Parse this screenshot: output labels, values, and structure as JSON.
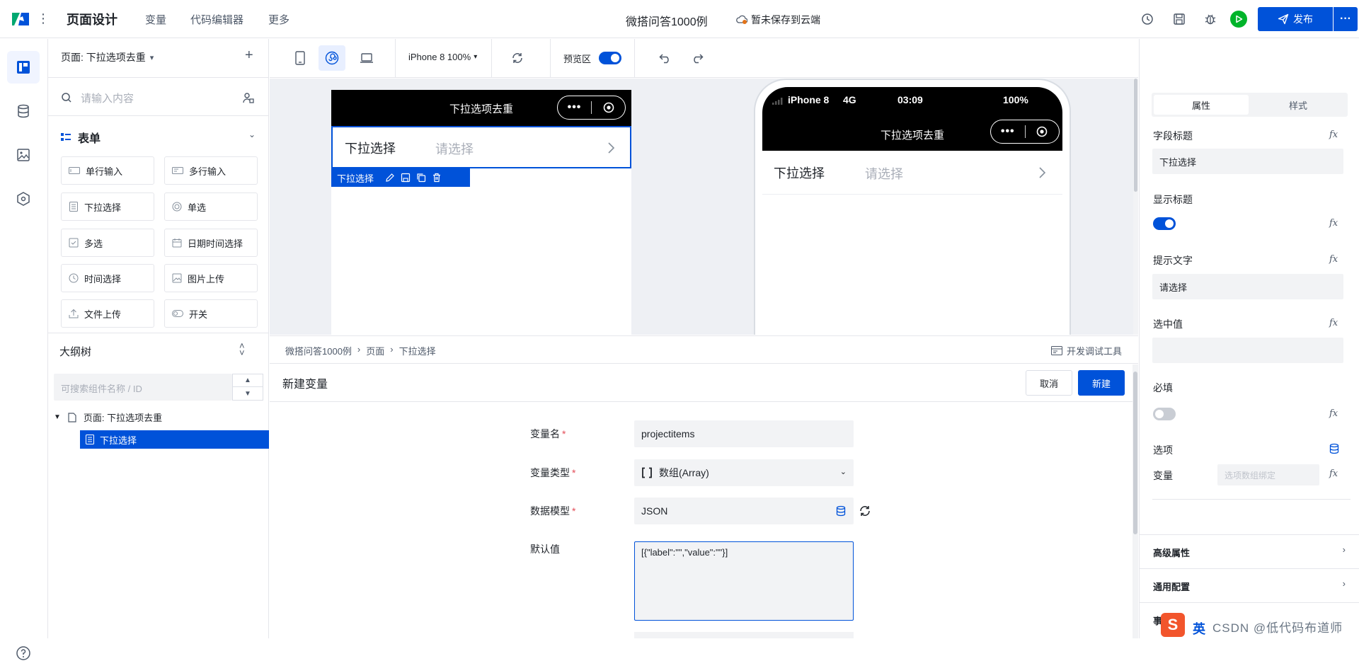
{
  "topbar": {
    "title": "页面设计",
    "nav": [
      "变量",
      "代码编辑器",
      "更多"
    ],
    "app_name": "微搭问答1000例",
    "cloud_status": "暂未保存到云端",
    "publish_label": "发布"
  },
  "leftpanel": {
    "page_label": "页面: 下拉选项去重",
    "search_placeholder": "请输入内容",
    "section_title": "表单",
    "components": [
      {
        "label": "单行输入",
        "icon": "input-icon"
      },
      {
        "label": "多行输入",
        "icon": "textarea-icon"
      },
      {
        "label": "下拉选择",
        "icon": "select-icon"
      },
      {
        "label": "单选",
        "icon": "radio-icon"
      },
      {
        "label": "多选",
        "icon": "checkbox-icon"
      },
      {
        "label": "日期时间选择",
        "icon": "calendar-icon"
      },
      {
        "label": "时间选择",
        "icon": "clock-icon"
      },
      {
        "label": "图片上传",
        "icon": "image-upload-icon"
      },
      {
        "label": "文件上传",
        "icon": "upload-icon"
      },
      {
        "label": "开关",
        "icon": "switch-icon"
      }
    ],
    "outline_title": "大纲树",
    "outline_search_placeholder": "可搜索组件名称 / ID",
    "tree": {
      "page": "页面: 下拉选项去重",
      "selected": "下拉选择"
    }
  },
  "toolbar": {
    "device": "iPhone 8 100%",
    "preview_label": "预览区",
    "preview_on": true
  },
  "canvas": {
    "nav_title": "下拉选项去重",
    "row_label": "下拉选择",
    "row_placeholder": "请选择",
    "selection_tag": "下拉选择",
    "phone_status": {
      "carrier": "iPhone 8",
      "network": "4G",
      "time": "03:09",
      "battery": "100%"
    }
  },
  "breadcrumb": {
    "items": [
      "微搭问答1000例",
      "页面",
      "下拉选择"
    ],
    "devtool_label": "开发调试工具"
  },
  "var_panel": {
    "title": "新建变量",
    "cancel_label": "取消",
    "create_label": "新建",
    "fields": {
      "name_label": "变量名",
      "name_value": "projectitems",
      "type_label": "变量类型",
      "type_value": "数组(Array)",
      "model_label": "数据模型",
      "model_value": "JSON",
      "default_label": "默认值",
      "default_value": "[{\"label\":\"\",\"value\":\"\"}]"
    }
  },
  "right_panel": {
    "tabs": [
      "属性",
      "样式"
    ],
    "active_tab": "属性",
    "field_title_label": "字段标题",
    "field_title_value": "下拉选择",
    "show_title_label": "显示标题",
    "show_title_on": true,
    "hint_label": "提示文字",
    "hint_value": "请选择",
    "selected_value_label": "选中值",
    "selected_value": "",
    "required_label": "必填",
    "required_on": false,
    "options_label": "选项",
    "variable_label": "变量",
    "variable_placeholder": "选项数组绑定",
    "fx_label": "fx",
    "sections": [
      "高级属性",
      "通用配置"
    ],
    "partial_label": "事"
  },
  "overlay": {
    "watermark": "CSDN @低代码布道师",
    "ime_label": "英"
  },
  "colors": {
    "primary": "#0052d9",
    "run_green": "#00b42a",
    "required_red": "#e34d59"
  }
}
